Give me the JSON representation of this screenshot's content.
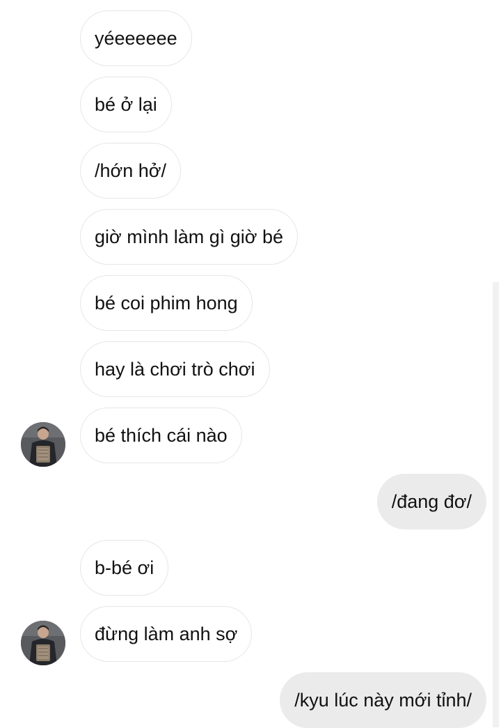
{
  "colors": {
    "received_bubble_bg": "#ffffff",
    "received_bubble_border": "#e6e6e6",
    "sent_bubble_bg": "#ebebeb",
    "text": "#111111"
  },
  "avatar_icon": "user-avatar-photo",
  "messages": [
    {
      "sender": "them",
      "text": "yéeeeeee"
    },
    {
      "sender": "them",
      "text": "bé ở lại"
    },
    {
      "sender": "them",
      "text": "/hớn hở/"
    },
    {
      "sender": "them",
      "text": "giờ mình làm gì giờ bé"
    },
    {
      "sender": "them",
      "text": "bé coi phim hong"
    },
    {
      "sender": "them",
      "text": "hay là chơi trò chơi"
    },
    {
      "sender": "them",
      "text": "bé thích cái nào"
    },
    {
      "sender": "me",
      "text": "/đang đơ/"
    },
    {
      "sender": "them",
      "text": "b-bé ơi"
    },
    {
      "sender": "them",
      "text": "đừng làm anh sợ"
    },
    {
      "sender": "me",
      "text": "/kyu lúc này mới tỉnh/"
    }
  ]
}
